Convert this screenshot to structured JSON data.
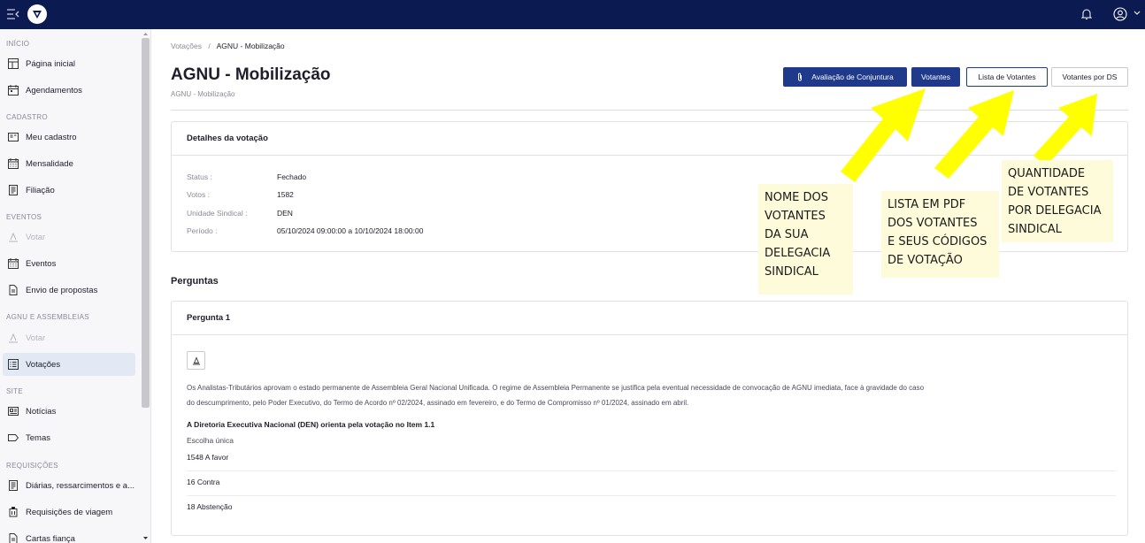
{
  "sidebar": {
    "sections": [
      {
        "label": "INÍCIO"
      },
      {
        "label": "CADASTRO"
      },
      {
        "label": "EVENTOS"
      },
      {
        "label": "AGNU E ASSEMBLEIAS"
      },
      {
        "label": "SITE"
      },
      {
        "label": "REQUISIÇÕES"
      }
    ],
    "items": [
      {
        "label": "Página inicial",
        "icon": "layout-icon"
      },
      {
        "label": "Agendamentos",
        "icon": "calendar-icon"
      },
      {
        "label": "Meu cadastro",
        "icon": "id-card-icon"
      },
      {
        "label": "Mensalidade",
        "icon": "calendar-grid-icon"
      },
      {
        "label": "Filiação",
        "icon": "document-icon"
      },
      {
        "label": "Votar",
        "icon": "vote-icon",
        "disabled": true
      },
      {
        "label": "Eventos",
        "icon": "calendar-grid-icon"
      },
      {
        "label": "Envio de propostas",
        "icon": "file-icon"
      },
      {
        "label": "Votar",
        "icon": "vote-icon",
        "disabled": true
      },
      {
        "label": "Votações",
        "icon": "list-icon",
        "active": true
      },
      {
        "label": "Notícias",
        "icon": "news-icon"
      },
      {
        "label": "Temas",
        "icon": "tag-icon"
      },
      {
        "label": "Diárias, ressarcimentos e a...",
        "icon": "document-icon"
      },
      {
        "label": "Requisições de viagem",
        "icon": "luggage-icon"
      },
      {
        "label": "Cartas fiança",
        "icon": "file-icon"
      }
    ]
  },
  "breadcrumb": {
    "parent": "Votações",
    "separator": "/",
    "current": "AGNU - Mobilização"
  },
  "page": {
    "title": "AGNU - Mobilização",
    "subtitle": "AGNU - Mobilização"
  },
  "actions": {
    "avaliacao": "Avaliação de Conjuntura",
    "votantes": "Votantes",
    "lista": "Lista de Votantes",
    "por_ds": "Votantes por DS"
  },
  "details": {
    "title": "Detalhes da votação",
    "rows": [
      {
        "key": "Status :",
        "value": "Fechado"
      },
      {
        "key": "Votos :",
        "value": "1582"
      },
      {
        "key": "Unidade Sindical :",
        "value": "DEN"
      },
      {
        "key": "Período :",
        "value": "05/10/2024 09:00:00 a 10/10/2024 18:00:00"
      }
    ]
  },
  "questions": {
    "section_title": "Perguntas",
    "q1": {
      "title": "Pergunta 1",
      "text_line1": "Os Analistas-Tributários aprovam o estado permanente de Assembleia Geral Nacional Unificada. O regime de Assembleia Permanente se justifica pela eventual necessidade de convocação de AGNU imediata, face à gravidade do caso",
      "text_line2": "do descumprimento, pelo Poder Executivo, do Termo de Acordo nº 02/2024, assinado em fevereiro, e do Termo de Compromisso nº 01/2024, assinado em abril.",
      "orientation": "A Diretoria Executiva Nacional (DEN) orienta pela votação no Item 1.1",
      "type": "Escolha única",
      "options": [
        {
          "label": "1548  A favor"
        },
        {
          "label": "16  Contra"
        },
        {
          "label": "18  Abstenção"
        }
      ]
    }
  },
  "annotations": {
    "votantes_note": [
      "NOME DOS",
      "VOTANTES",
      "DA SUA",
      "DELEGACIA",
      "SINDICAL"
    ],
    "lista_note": [
      "LISTA EM PDF",
      "DOS VOTANTES",
      "E SEUS CÓDIGOS",
      "DE VOTAÇÃO"
    ],
    "ds_note": [
      "QUANTIDADE",
      "DE VOTANTES",
      "POR DELEGACIA",
      "SINDICAL"
    ]
  },
  "colors": {
    "topbar": "#0c1a52",
    "primary": "#1f3a8a",
    "arrow": "#ffff00",
    "note_bg": "#fdfbd9"
  }
}
